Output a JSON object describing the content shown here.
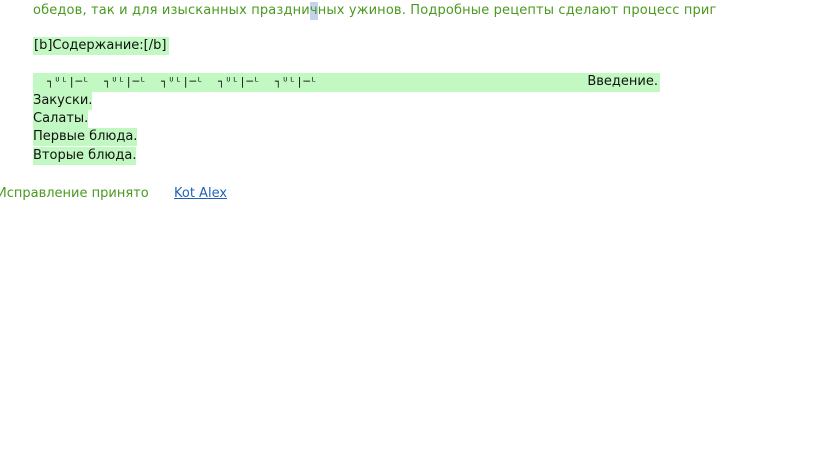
{
  "content": {
    "intro_text_before": "обедов, так и для изысканных праздни",
    "intro_text_highlight": "ч",
    "intro_text_after": "ных ужинов. Подробные рецепты сделают процесс приг",
    "toc_heading": "[b]Содержание:[/b]",
    "toc_glyphs": "┐ᵁᴸ|─ᴸ  ┐ᵁᴸ|─ᴸ  ┐ᵁᴸ|─ᴸ  ┐ᵁᴸ|─ᴸ  ┐ᵁᴸ|─ᴸ",
    "toc_items": [
      "Введение.",
      "Закуски.",
      "Салаты.",
      "Первые блюда.",
      "Вторые блюда."
    ]
  },
  "status": {
    "text": "Исправление принято",
    "author": "Kot Alex"
  },
  "colors": {
    "green_text": "#4a9a1f",
    "highlight_bg": "#c2f9c2",
    "link": "#1f63b8"
  }
}
